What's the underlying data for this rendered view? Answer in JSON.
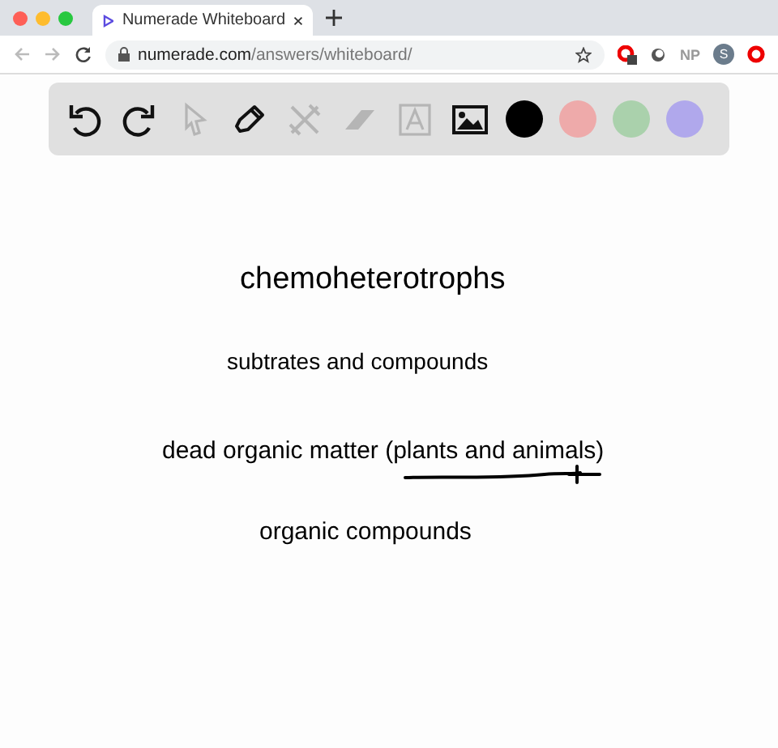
{
  "browser": {
    "tab_title": "Numerade Whiteboard",
    "url_host": "numerade.com",
    "url_path": "/answers/whiteboard/",
    "extension_label": "NP",
    "avatar_letter": "S"
  },
  "toolbar": {
    "tools": [
      {
        "kind": "undo",
        "disabled": false
      },
      {
        "kind": "redo",
        "disabled": false
      },
      {
        "kind": "pointer",
        "disabled": true
      },
      {
        "kind": "pen",
        "disabled": false
      },
      {
        "kind": "tools",
        "disabled": true
      },
      {
        "kind": "eraser",
        "disabled": true
      },
      {
        "kind": "text",
        "disabled": true
      },
      {
        "kind": "image",
        "disabled": false
      }
    ],
    "colors": [
      {
        "color": "#000000"
      },
      {
        "color": "#eeaaaa"
      },
      {
        "color": "#aad1ac"
      },
      {
        "color": "#b0a8ec"
      }
    ]
  },
  "whiteboard": {
    "notes": [
      {
        "text": "chemoheterotrophs",
        "kind": "title"
      },
      {
        "text": "subtrates and compounds",
        "kind": "note"
      },
      {
        "text": "dead organic matter (plants and animals)",
        "kind": "note",
        "underlined": true
      },
      {
        "text": "organic compounds",
        "kind": "note"
      }
    ]
  }
}
